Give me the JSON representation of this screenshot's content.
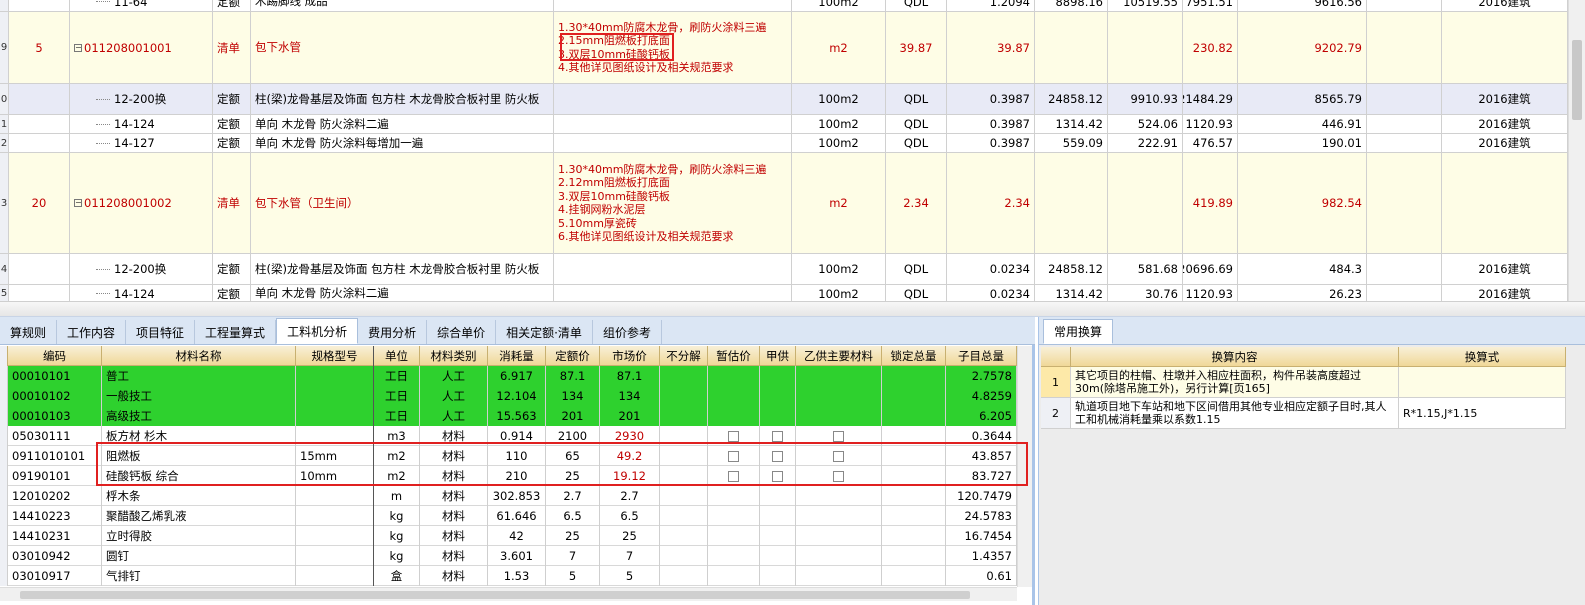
{
  "top_rows": [
    {
      "row_no": "",
      "seq": "",
      "code": "11-64",
      "type": "定额",
      "name": "木踢脚线 成品",
      "features": [],
      "unit": "100m2",
      "qty_expr": "QDL",
      "qty": "1.2094",
      "price": "8898.16",
      "c1": "10519.55",
      "c2": "7951.51",
      "c3": "9616.56",
      "spec": "2016建筑"
    },
    {
      "row_no": "9",
      "seq": "5",
      "code": "011208001001",
      "type": "清单",
      "name": "包下水管",
      "features": [
        "1.30*40mm防腐木龙骨，刷防火涂料三遍",
        "2.15mm阻燃板打底面",
        "3.双层10mm硅酸钙板",
        "4.其他详见图纸设计及相关规范要求"
      ],
      "unit": "m2",
      "qty_expr": "39.87",
      "qty": "39.87",
      "price": "",
      "c1": "",
      "c2": "230.82",
      "c3": "9202.79",
      "spec": ""
    },
    {
      "row_no": "0",
      "seq": "",
      "code": "12-200换",
      "type": "定额",
      "name": "柱(梁)龙骨基层及饰面 包方柱 木龙骨胶合板衬里 防火板",
      "features": [],
      "unit": "100m2",
      "qty_expr": "QDL",
      "qty": "0.3987",
      "price": "24858.12",
      "c1": "9910.93",
      "c2": "21484.29",
      "c3": "8565.79",
      "spec": "2016建筑"
    },
    {
      "row_no": "1",
      "seq": "",
      "code": "14-124",
      "type": "定额",
      "name": "单向 木龙骨 防火涂料二遍",
      "features": [],
      "unit": "100m2",
      "qty_expr": "QDL",
      "qty": "0.3987",
      "price": "1314.42",
      "c1": "524.06",
      "c2": "1120.93",
      "c3": "446.91",
      "spec": "2016建筑"
    },
    {
      "row_no": "2",
      "seq": "",
      "code": "14-127",
      "type": "定额",
      "name": "单向 木龙骨 防火涂料每增加一遍",
      "features": [],
      "unit": "100m2",
      "qty_expr": "QDL",
      "qty": "0.3987",
      "price": "559.09",
      "c1": "222.91",
      "c2": "476.57",
      "c3": "190.01",
      "spec": "2016建筑"
    },
    {
      "row_no": "3",
      "seq": "20",
      "code": "011208001002",
      "type": "清单",
      "name": "包下水管（卫生间）",
      "features": [
        "1.30*40mm防腐木龙骨，刷防火涂料三遍",
        "2.12mm阻燃板打底面",
        "3.双层10mm硅酸钙板",
        "4.挂钢网粉水泥层",
        "5.10mm厚瓷砖",
        "6.其他详见图纸设计及相关规范要求"
      ],
      "unit": "m2",
      "qty_expr": "2.34",
      "qty": "2.34",
      "price": "",
      "c1": "",
      "c2": "419.89",
      "c3": "982.54",
      "spec": ""
    },
    {
      "row_no": "4",
      "seq": "",
      "code": "12-200换",
      "type": "定额",
      "name": "柱(梁)龙骨基层及饰面 包方柱 木龙骨胶合板衬里 防火板",
      "features": [],
      "unit": "100m2",
      "qty_expr": "QDL",
      "qty": "0.0234",
      "price": "24858.12",
      "c1": "581.68",
      "c2": "20696.69",
      "c3": "484.3",
      "spec": "2016建筑"
    },
    {
      "row_no": "5",
      "seq": "",
      "code": "14-124",
      "type": "定额",
      "name": "单向 木龙骨 防火涂料二遍",
      "features": [],
      "unit": "100m2",
      "qty_expr": "QDL",
      "qty": "0.0234",
      "price": "1314.42",
      "c1": "30.76",
      "c2": "1120.93",
      "c3": "26.23",
      "spec": "2016建筑"
    }
  ],
  "tabs": [
    "算规则",
    "工作内容",
    "项目特征",
    "工程量算式",
    "工料机分析",
    "费用分析",
    "综合单价",
    "相关定额·清单",
    "组价参考"
  ],
  "active_tab": "工料机分析",
  "mat_headers": [
    "编码",
    "材料名称",
    "规格型号",
    "单位",
    "材料类别",
    "消耗量",
    "定额价",
    "市场价",
    "不分解",
    "暂估价",
    "甲供",
    "乙供主要材料",
    "锁定总量",
    "子目总量"
  ],
  "mat_rows": [
    {
      "code": "00010101",
      "name": "普工",
      "spec": "",
      "unit": "工日",
      "cat": "人工",
      "qty": "6.917",
      "base": "87.1",
      "market": "87.1",
      "total": "2.7578",
      "green": true,
      "checks": false,
      "red": false
    },
    {
      "code": "00010102",
      "name": "一般技工",
      "spec": "",
      "unit": "工日",
      "cat": "人工",
      "qty": "12.104",
      "base": "134",
      "market": "134",
      "total": "4.8259",
      "green": true,
      "checks": false,
      "red": false
    },
    {
      "code": "00010103",
      "name": "高级技工",
      "spec": "",
      "unit": "工日",
      "cat": "人工",
      "qty": "15.563",
      "base": "201",
      "market": "201",
      "total": "6.205",
      "green": true,
      "checks": false,
      "red": false
    },
    {
      "code": "05030111",
      "name": "板方材 杉木",
      "spec": "",
      "unit": "m3",
      "cat": "材料",
      "qty": "0.914",
      "base": "2100",
      "market": "2930",
      "total": "0.3644",
      "green": false,
      "checks": true,
      "red": true
    },
    {
      "code": "0911010101",
      "name": "阻燃板",
      "spec": "15mm",
      "unit": "m2",
      "cat": "材料",
      "qty": "110",
      "base": "65",
      "market": "49.2",
      "total": "43.857",
      "green": false,
      "checks": true,
      "red": true
    },
    {
      "code": "09190101",
      "name": "硅酸钙板 综合",
      "spec": "10mm",
      "unit": "m2",
      "cat": "材料",
      "qty": "210",
      "base": "25",
      "market": "19.12",
      "total": "83.727",
      "green": false,
      "checks": true,
      "red": true
    },
    {
      "code": "12010202",
      "name": "桴木条",
      "spec": "",
      "unit": "m",
      "cat": "材料",
      "qty": "302.853",
      "base": "2.7",
      "market": "2.7",
      "total": "120.7479",
      "green": false,
      "checks": false,
      "red": false
    },
    {
      "code": "14410223",
      "name": "聚醋酸乙烯乳液",
      "spec": "",
      "unit": "kg",
      "cat": "材料",
      "qty": "61.646",
      "base": "6.5",
      "market": "6.5",
      "total": "24.5783",
      "green": false,
      "checks": false,
      "red": false
    },
    {
      "code": "14410231",
      "name": "立时得胶",
      "spec": "",
      "unit": "kg",
      "cat": "材料",
      "qty": "42",
      "base": "25",
      "market": "25",
      "total": "16.7454",
      "green": false,
      "checks": false,
      "red": false
    },
    {
      "code": "03010942",
      "name": "圆钉",
      "spec": "",
      "unit": "kg",
      "cat": "材料",
      "qty": "3.601",
      "base": "7",
      "market": "7",
      "total": "1.4357",
      "green": false,
      "checks": false,
      "red": false
    },
    {
      "code": "03010917",
      "name": "气排钉",
      "spec": "",
      "unit": "盒",
      "cat": "材料",
      "qty": "1.53",
      "base": "5",
      "market": "5",
      "total": "0.61",
      "green": false,
      "checks": false,
      "red": false
    }
  ],
  "right_tab": "常用换算",
  "conv_headers": [
    "换算内容",
    "换算式"
  ],
  "conv_rows": [
    {
      "no": "1",
      "content": "其它项目的柱帽、柱墩并入相应柱面积，构件吊装高度超过30m(除塔吊施工外)，另行计算[页165]",
      "expr": ""
    },
    {
      "no": "2",
      "content": "轨道项目地下车站和地下区间借用其他专业相应定额子目时,其人工和机械消耗量乘以系数1.15",
      "expr": "R*1.15,J*1.15"
    }
  ]
}
